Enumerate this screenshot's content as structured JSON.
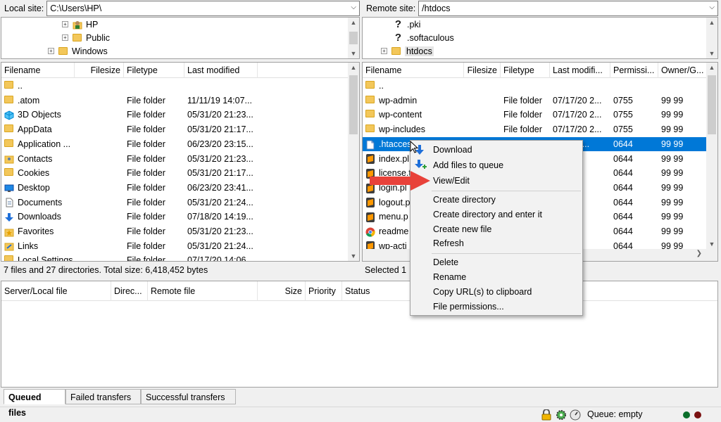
{
  "local": {
    "label": "Local site:",
    "path": "C:\\Users\\HP\\",
    "tree": [
      "HP",
      "Public",
      "Windows"
    ],
    "columns": [
      "Filename",
      "Filesize",
      "Filetype",
      "Last modified"
    ],
    "rows": [
      {
        "name": "..",
        "type": "",
        "modified": ""
      },
      {
        "name": ".atom",
        "type": "File folder",
        "modified": "11/11/19 14:07..."
      },
      {
        "name": "3D Objects",
        "type": "File folder",
        "modified": "05/31/20 21:23..."
      },
      {
        "name": "AppData",
        "type": "File folder",
        "modified": "05/31/20 21:17..."
      },
      {
        "name": "Application ...",
        "type": "File folder",
        "modified": "06/23/20 23:15..."
      },
      {
        "name": "Contacts",
        "type": "File folder",
        "modified": "05/31/20 21:23..."
      },
      {
        "name": "Cookies",
        "type": "File folder",
        "modified": "05/31/20 21:17..."
      },
      {
        "name": "Desktop",
        "type": "File folder",
        "modified": "06/23/20 23:41..."
      },
      {
        "name": "Documents",
        "type": "File folder",
        "modified": "05/31/20 21:24..."
      },
      {
        "name": "Downloads",
        "type": "File folder",
        "modified": "07/18/20 14:19..."
      },
      {
        "name": "Favorites",
        "type": "File folder",
        "modified": "05/31/20 21:23..."
      },
      {
        "name": "Links",
        "type": "File folder",
        "modified": "05/31/20 21:24..."
      },
      {
        "name": "Local Settings",
        "type": "File folder",
        "modified": "07/17/20 14:06..."
      }
    ],
    "status": "7 files and 27 directories. Total size: 6,418,452 bytes"
  },
  "remote": {
    "label": "Remote site:",
    "path": "/htdocs",
    "tree": [
      ".pki",
      ".softaculous",
      "htdocs"
    ],
    "columns": [
      "Filename",
      "Filesize",
      "Filetype",
      "Last modifi...",
      "Permissi...",
      "Owner/G..."
    ],
    "rows": [
      {
        "name": "..",
        "type": "",
        "modified": "",
        "perm": "",
        "owner": ""
      },
      {
        "name": "wp-admin",
        "type": "File folder",
        "modified": "07/17/20 2...",
        "perm": "0755",
        "owner": "99 99"
      },
      {
        "name": "wp-content",
        "type": "File folder",
        "modified": "07/17/20 2...",
        "perm": "0755",
        "owner": "99 99"
      },
      {
        "name": "wp-includes",
        "type": "File folder",
        "modified": "07/17/20 2...",
        "perm": "0755",
        "owner": "99 99"
      },
      {
        "name": ".htaccess",
        "type": "",
        "modified": "07/20 2...",
        "perm": "0644",
        "owner": "99 99"
      },
      {
        "name": "index.php",
        "type": "",
        "modified": "20 1...",
        "perm": "0644",
        "owner": "99 99"
      },
      {
        "name": "license.txt",
        "type": "",
        "modified": "20 2...",
        "perm": "0644",
        "owner": "99 99"
      },
      {
        "name": "login.php",
        "type": "",
        "modified": "18 2...",
        "perm": "0644",
        "owner": "99 99"
      },
      {
        "name": "logout.php",
        "type": "",
        "modified": "18 2...",
        "perm": "0644",
        "owner": "99 99"
      },
      {
        "name": "menu.php",
        "type": "",
        "modified": "18 2...",
        "perm": "0644",
        "owner": "99 99"
      },
      {
        "name": "readme.html",
        "type": "",
        "modified": "20 2...",
        "perm": "0644",
        "owner": "99 99"
      },
      {
        "name": "wp-activate.php",
        "type": "",
        "modified": "20 1...",
        "perm": "0644",
        "owner": "99 99"
      }
    ],
    "visible_names": [
      "..",
      "wp-admin",
      "wp-content",
      "wp-includes",
      ".htacces",
      "index.pl",
      "license.t",
      "login.pl",
      "logout.p",
      "menu.p",
      "readme",
      "wp-acti"
    ],
    "status": "Selected 1"
  },
  "context_menu": {
    "download": "Download",
    "add_to_queue": "Add files to queue",
    "view_edit": "View/Edit",
    "create_dir": "Create directory",
    "create_dir_enter": "Create directory and enter it",
    "create_file": "Create new file",
    "refresh": "Refresh",
    "delete": "Delete",
    "rename": "Rename",
    "copy_url": "Copy URL(s) to clipboard",
    "file_perms": "File permissions..."
  },
  "queue": {
    "columns": [
      "Server/Local file",
      "Direc...",
      "Remote file",
      "Size",
      "Priority",
      "Status"
    ]
  },
  "tabs": [
    "Queued files",
    "Failed transfers",
    "Successful transfers"
  ],
  "statusbar": {
    "queue": "Queue: empty"
  },
  "colors": {
    "selection": "#0078d7",
    "arrow": "#e8423a",
    "folder": "#f3c75a"
  }
}
